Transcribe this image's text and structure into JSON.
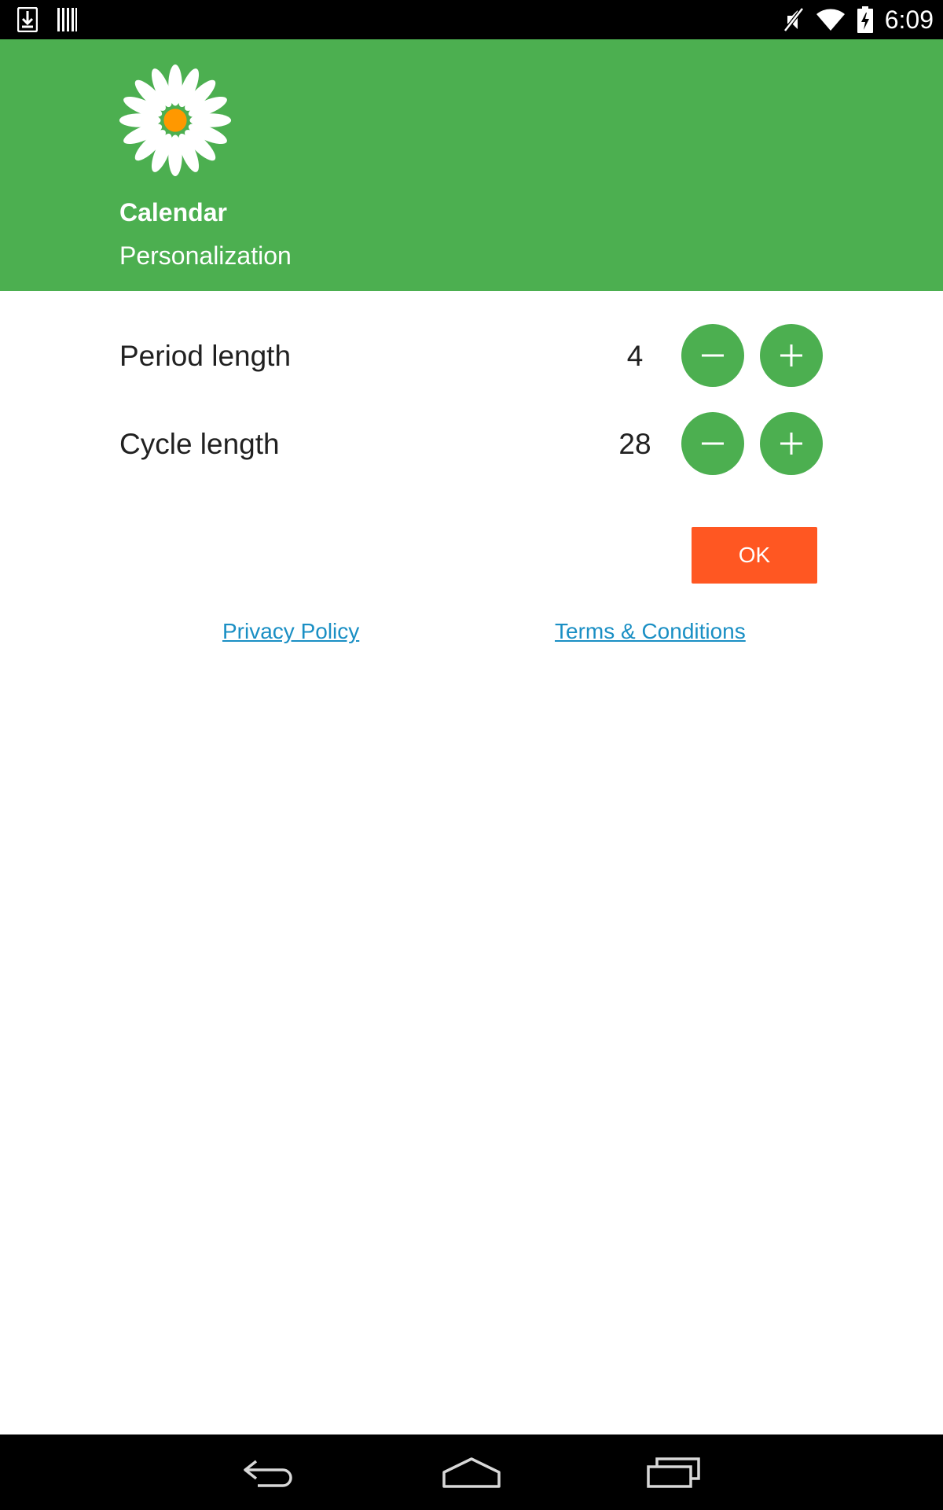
{
  "status_bar": {
    "time": "6:09",
    "left_icons": [
      "download-icon",
      "barcode-icon"
    ],
    "right_icons": [
      "mute-icon",
      "wifi-icon",
      "battery-charging-icon"
    ]
  },
  "header": {
    "title": "Calendar",
    "subtitle": "Personalization",
    "background_color": "#4caf50",
    "logo": "daisy-logo"
  },
  "settings": {
    "period": {
      "label": "Period length",
      "value": "4"
    },
    "cycle": {
      "label": "Cycle length",
      "value": "28"
    }
  },
  "buttons": {
    "ok_label": "OK",
    "ok_color": "#ff5722",
    "stepper_color": "#4caf50"
  },
  "links": {
    "privacy": "Privacy Policy",
    "terms": "Terms & Conditions",
    "color": "#1a8fc4"
  },
  "nav_bar": {
    "icons": [
      "back-icon",
      "home-icon",
      "recents-icon"
    ]
  }
}
